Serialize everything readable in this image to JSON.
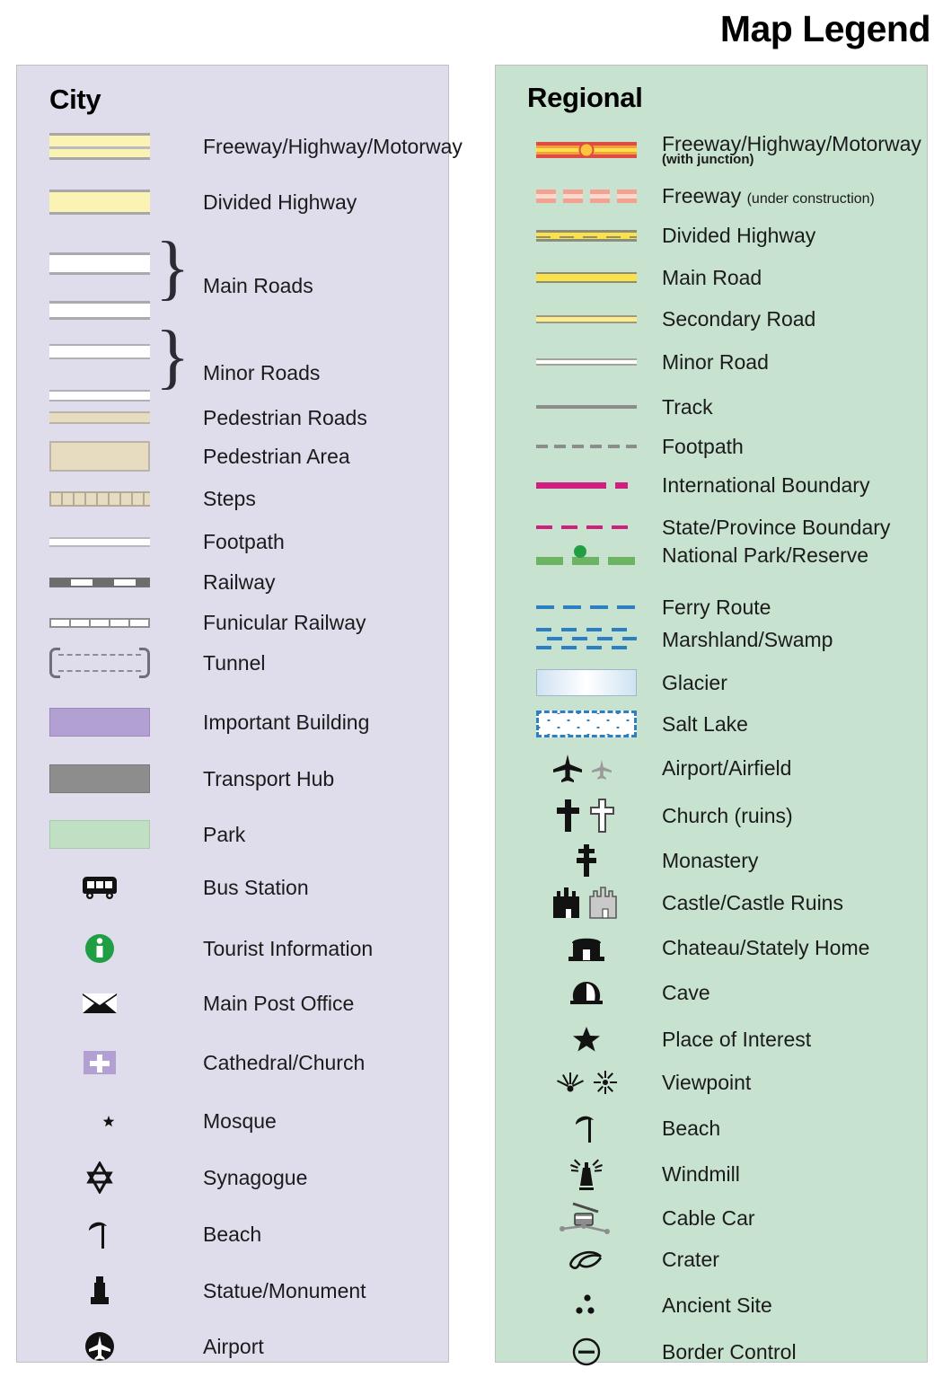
{
  "title": "Map Legend",
  "city": {
    "heading": "City",
    "items": [
      {
        "label": "Freeway/Highway/Motorway",
        "symbol": "freeway-swatch"
      },
      {
        "label": "Divided Highway",
        "symbol": "divided-highway-swatch"
      },
      {
        "label": "Main Roads",
        "symbol": "main-roads-swatch-pair"
      },
      {
        "label": "Minor Roads",
        "symbol": "minor-roads-swatch-pair"
      },
      {
        "label": "Pedestrian Roads",
        "symbol": "pedestrian-road-swatch"
      },
      {
        "label": "Pedestrian Area",
        "symbol": "pedestrian-area-swatch"
      },
      {
        "label": "Steps",
        "symbol": "steps-swatch"
      },
      {
        "label": "Footpath",
        "symbol": "footpath-swatch"
      },
      {
        "label": "Railway",
        "symbol": "railway-swatch"
      },
      {
        "label": "Funicular Railway",
        "symbol": "funicular-railway-swatch"
      },
      {
        "label": "Tunnel",
        "symbol": "tunnel-swatch"
      },
      {
        "label": "Important Building",
        "symbol": "important-building-swatch"
      },
      {
        "label": "Transport Hub",
        "symbol": "transport-hub-swatch"
      },
      {
        "label": "Park",
        "symbol": "park-swatch"
      },
      {
        "label": "Bus Station",
        "symbol": "bus-icon"
      },
      {
        "label": "Tourist Information",
        "symbol": "information-icon"
      },
      {
        "label": "Main Post Office",
        "symbol": "envelope-icon"
      },
      {
        "label": "Cathedral/Church",
        "symbol": "church-cross-icon"
      },
      {
        "label": "Mosque",
        "symbol": "crescent-star-icon"
      },
      {
        "label": "Synagogue",
        "symbol": "star-of-david-icon"
      },
      {
        "label": "Beach",
        "symbol": "beach-umbrella-icon"
      },
      {
        "label": "Statue/Monument",
        "symbol": "statue-icon"
      },
      {
        "label": "Airport",
        "symbol": "airport-icon"
      }
    ]
  },
  "regional": {
    "heading": "Regional",
    "items": [
      {
        "label": "Freeway/Highway/Motorway",
        "sublabel": "(with junction)",
        "symbol": "freeway-junction-line"
      },
      {
        "label": "Freeway",
        "sublabel": "(under construction)",
        "symbol": "freeway-under-construction-line"
      },
      {
        "label": "Divided Highway",
        "symbol": "divided-highway-line"
      },
      {
        "label": "Main Road",
        "symbol": "main-road-line"
      },
      {
        "label": "Secondary Road",
        "symbol": "secondary-road-line"
      },
      {
        "label": "Minor Road",
        "symbol": "minor-road-line"
      },
      {
        "label": "Track",
        "symbol": "track-line"
      },
      {
        "label": "Footpath",
        "symbol": "footpath-line"
      },
      {
        "label": "International Boundary",
        "symbol": "international-boundary-line"
      },
      {
        "label": "State/Province Boundary",
        "symbol": "state-boundary-line"
      },
      {
        "label": "National Park/Reserve",
        "symbol": "national-park-line"
      },
      {
        "label": "Ferry Route",
        "symbol": "ferry-route-line"
      },
      {
        "label": "Marshland/Swamp",
        "symbol": "marshland-pattern"
      },
      {
        "label": "Glacier",
        "symbol": "glacier-swatch"
      },
      {
        "label": "Salt Lake",
        "symbol": "salt-lake-swatch"
      },
      {
        "label": "Airport/Airfield",
        "symbol": "airplane-icon-pair"
      },
      {
        "label": "Church (ruins)",
        "symbol": "cross-icon-pair"
      },
      {
        "label": "Monastery",
        "symbol": "monastery-cross-icon"
      },
      {
        "label": "Castle/Castle Ruins",
        "symbol": "castle-icon-pair"
      },
      {
        "label": "Chateau/Stately Home",
        "symbol": "chateau-icon"
      },
      {
        "label": "Cave",
        "symbol": "cave-icon"
      },
      {
        "label": "Place of Interest",
        "symbol": "star-icon"
      },
      {
        "label": "Viewpoint",
        "symbol": "viewpoint-icon-pair"
      },
      {
        "label": "Beach",
        "symbol": "beach-umbrella-icon"
      },
      {
        "label": "Windmill",
        "symbol": "windmill-icon"
      },
      {
        "label": "Cable Car",
        "symbol": "cable-car-icon"
      },
      {
        "label": "Crater",
        "symbol": "crater-icon"
      },
      {
        "label": "Ancient Site",
        "symbol": "ancient-site-icon"
      },
      {
        "label": "Border Control",
        "symbol": "border-control-icon"
      }
    ]
  },
  "colors": {
    "city_panel_bg": "#dfdcec",
    "regional_panel_bg": "#c7e2ce",
    "highway_yellow": "#fbf3b4",
    "road_yellow": "#fbe14a",
    "pedestrian_tan": "#e8dcc0",
    "important_building_purple": "#b3a0d2",
    "transport_hub_gray": "#8d8d8d",
    "park_green": "#bfe0c2",
    "freeway_red": "#e04b42",
    "boundary_magenta": "#cf2080",
    "water_blue": "#2d7fc4",
    "park_line_green": "#6cb464",
    "info_green": "#1f9e44"
  }
}
